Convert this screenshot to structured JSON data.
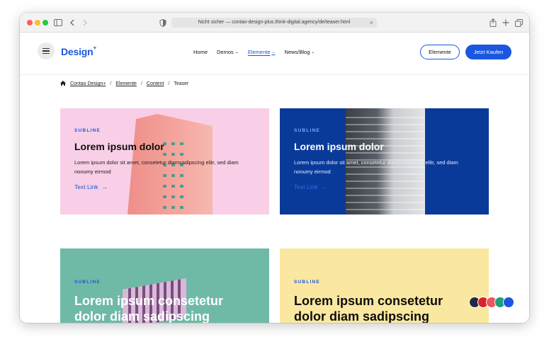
{
  "browser": {
    "url": "Nicht sicher — contao-design-plus.think-digital.agency/de/teaser.html",
    "close_glyph": "×"
  },
  "header": {
    "logo": "Design",
    "logo_sup": "+",
    "nav": [
      {
        "label": "Home",
        "chev": ""
      },
      {
        "label": "Demos",
        "chev": "⌄"
      },
      {
        "label": "Elemente",
        "chev": "⌄"
      },
      {
        "label": "News/Blog",
        "chev": "⌄"
      }
    ],
    "btn_outline": "Elemente",
    "btn_primary": "Jetzt Kaufen"
  },
  "breadcrumb": {
    "items": [
      "Contao Design+",
      "Elemente",
      "Content"
    ],
    "current": "Teaser",
    "sep": "/"
  },
  "cards": [
    {
      "subline": "SUBLINE",
      "title": "Lorem ipsum dolor",
      "body": "Lorem ipsum dolor sit amet, consetetur diamsadipscing elitr, sed diam nonumy eirmod",
      "link": "Text Link",
      "arrow": "→"
    },
    {
      "subline": "SUBLINE",
      "title": "Lorem ipsum dolor",
      "body": "Lorem ipsum dolor sit amet, consetetur diamsadipscing elitr, sed diam nonumy eirmod",
      "link": "Text Link",
      "arrow": "→"
    },
    {
      "subline": "SUBLINE",
      "title": "Lorem ipsum consetetur dolor diam sadipscing"
    },
    {
      "subline": "SUBLINE",
      "title": "Lorem ipsum consetetur dolor diam sadipscing"
    }
  ],
  "swatches": [
    "#1f2a44",
    "#d9232e",
    "#e9575f",
    "#1f9e7c",
    "#1a56e0"
  ],
  "colors": {
    "accent": "#1a56e0"
  }
}
